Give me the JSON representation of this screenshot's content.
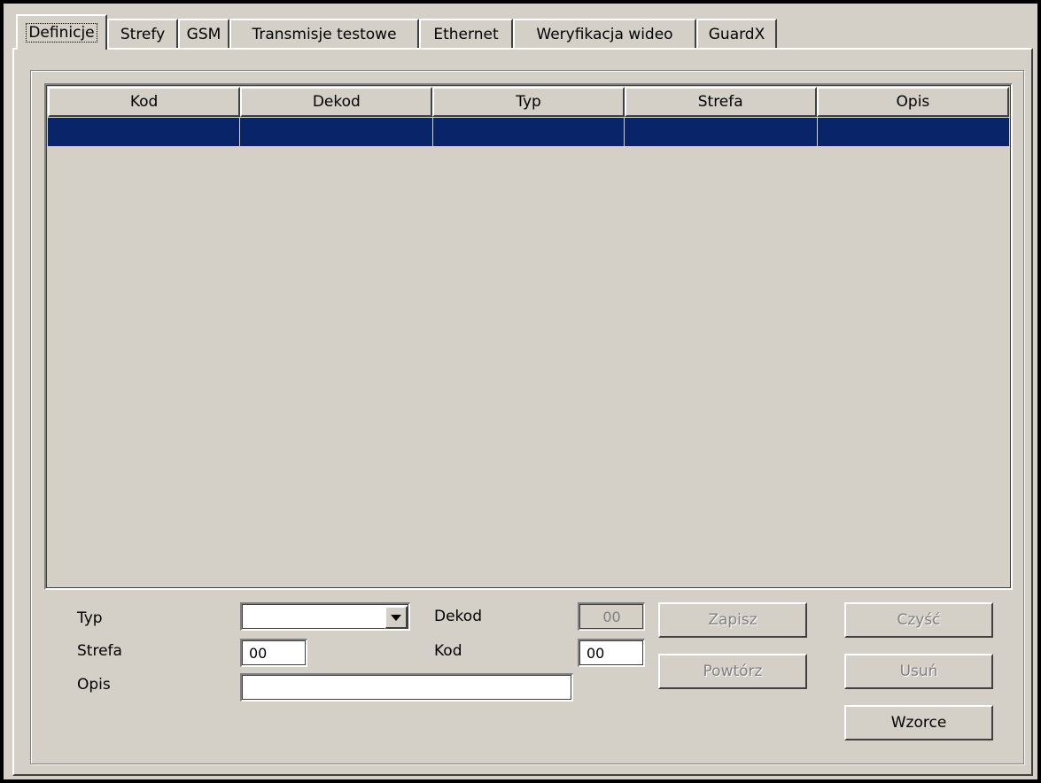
{
  "tabs": [
    {
      "label": "Definicje",
      "active": true
    },
    {
      "label": "Strefy"
    },
    {
      "label": "GSM"
    },
    {
      "label": "Transmisje testowe"
    },
    {
      "label": "Ethernet"
    },
    {
      "label": "Weryfikacja wideo"
    },
    {
      "label": "GuardX"
    }
  ],
  "table": {
    "columns": [
      "Kod",
      "Dekod",
      "Typ",
      "Strefa",
      "Opis"
    ],
    "selected_row": [
      "",
      "",
      "",
      "",
      ""
    ]
  },
  "form": {
    "typ_label": "Typ",
    "typ_value": "",
    "strefa_label": "Strefa",
    "strefa_value": "00",
    "opis_label": "Opis",
    "opis_value": "",
    "dekod_label": "Dekod",
    "dekod_value": "00",
    "kod_label": "Kod",
    "kod_value": "00"
  },
  "buttons": {
    "zapisz": "Zapisz",
    "czysc": "Czyść",
    "powtorz": "Powtórz",
    "usun": "Usuń",
    "wzorce": "Wzorce"
  },
  "colors": {
    "face": "#d4d0c8",
    "selection": "#0a246a"
  }
}
